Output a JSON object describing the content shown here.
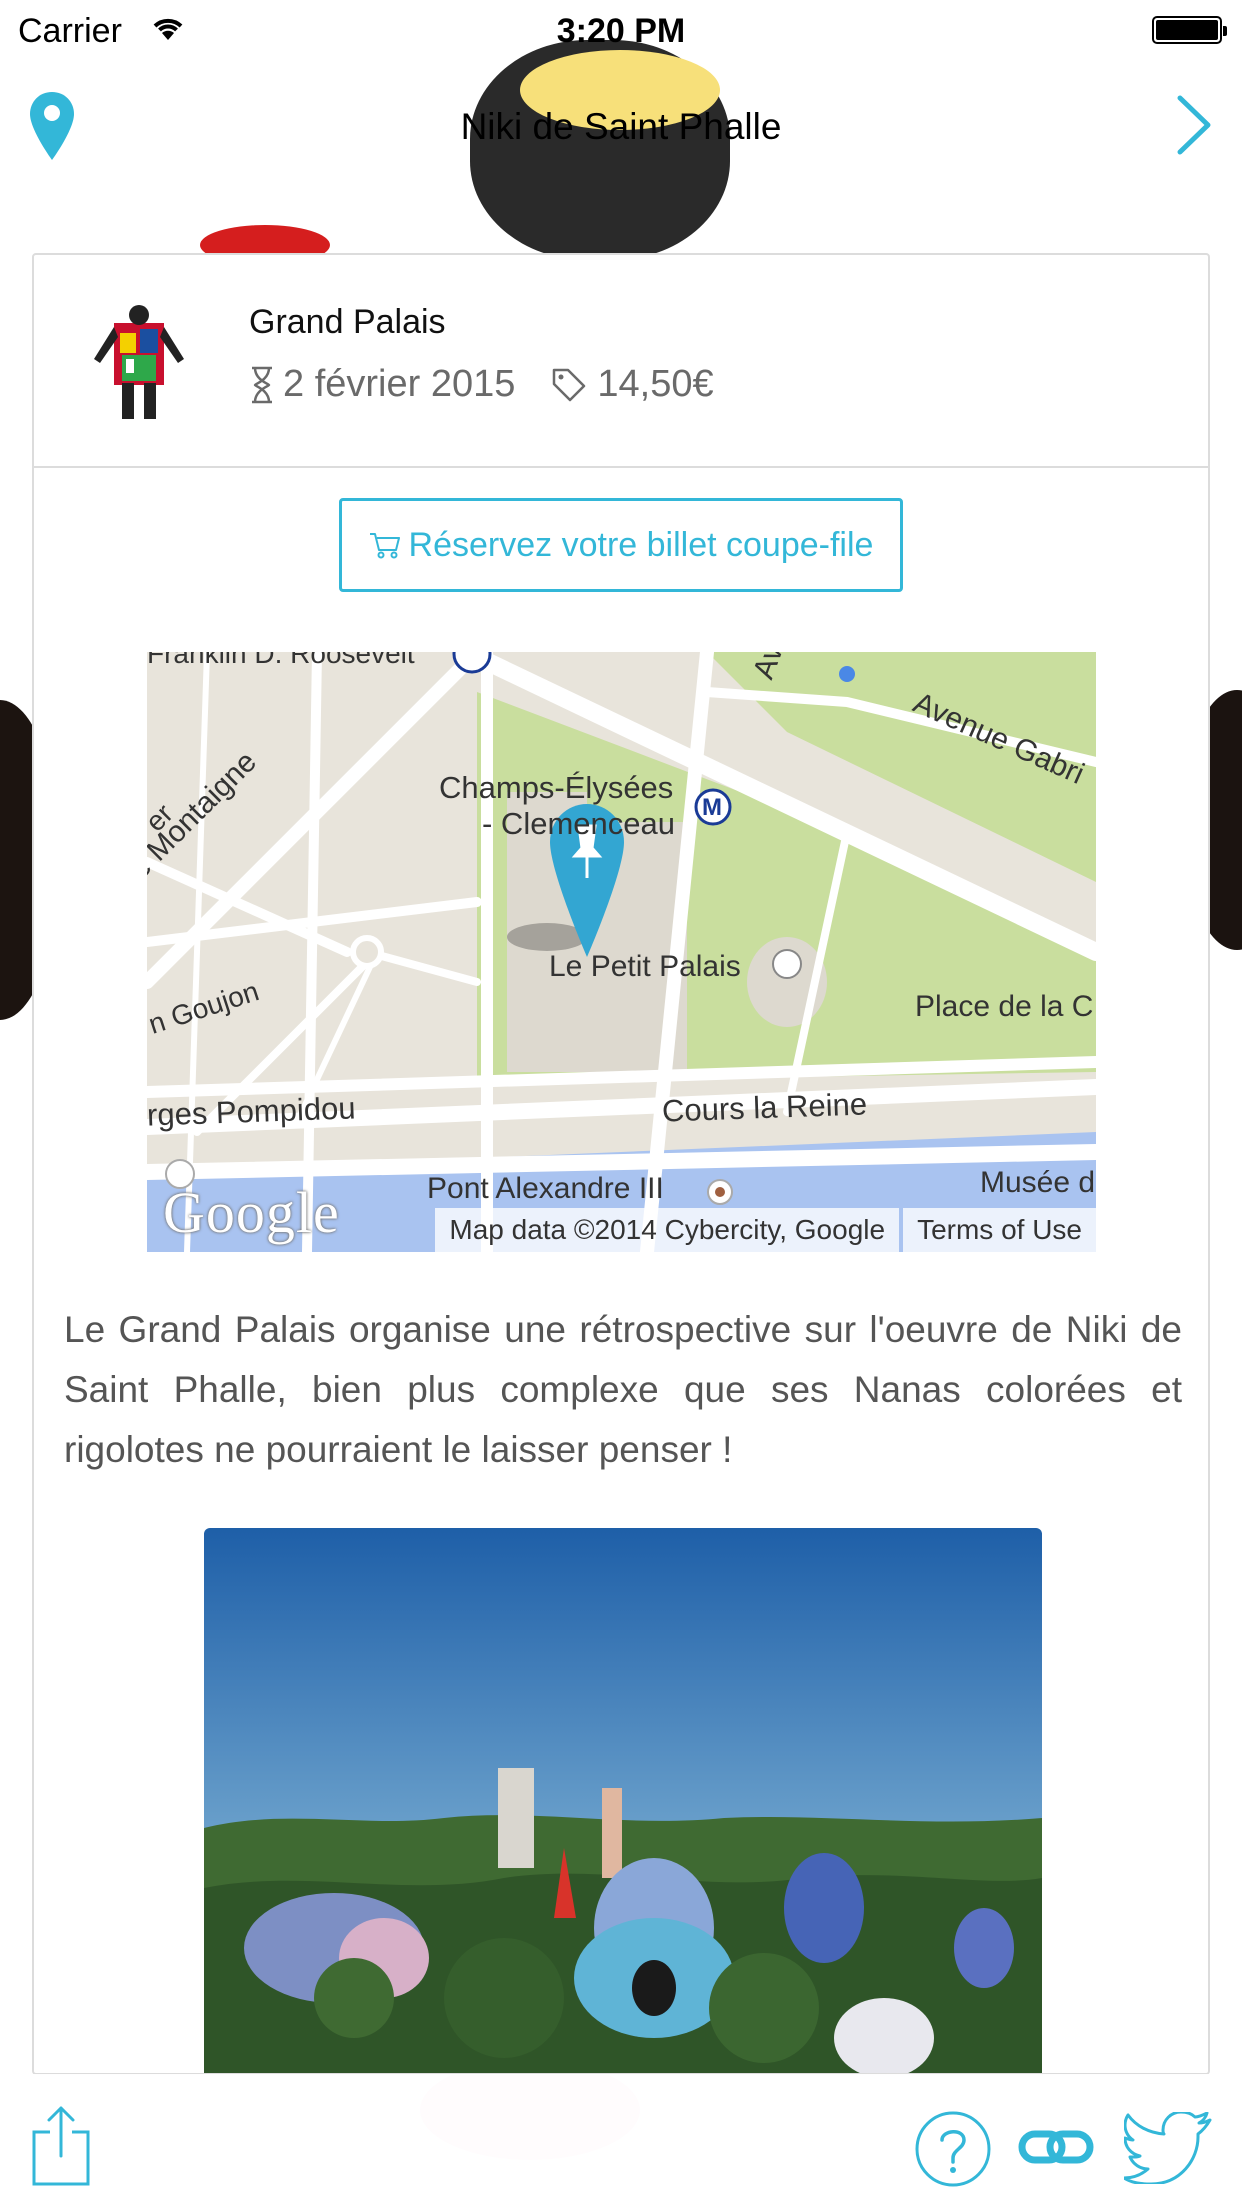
{
  "status_bar": {
    "carrier": "Carrier",
    "time": "3:20 PM"
  },
  "nav": {
    "title": "Niki de Saint Phalle",
    "left_icon": "map-pin-icon",
    "right_icon": "chevron-right-icon"
  },
  "event": {
    "venue": "Grand Palais",
    "end_date": "2 février 2015",
    "price": "14,50€"
  },
  "cta": {
    "label": "Réservez votre billet coupe-file"
  },
  "map": {
    "labels": {
      "roosevelt": "Franklin D. Roosevelt",
      "montaigne": "e Montaigne",
      "champs": "Champs-Élysées",
      "clemenceau": "- Clemenceau",
      "avenue": "Avenu",
      "avenue_gabriel": "Avenue Gabri",
      "petit_palais": "Le Petit Palais",
      "goujon": "n Goujon",
      "place": "Place de la C",
      "pompidou": "rges Pompidou",
      "cours": "Cours la Reine",
      "pont": "Pont Alexandre III",
      "musee": "Musée d",
      "er": "er"
    },
    "google_logo": "Google",
    "attribution": "Map data ©2014 Cybercity, Google",
    "terms": "Terms of Use"
  },
  "description": "Le Grand Palais organise une rétrospective sur l'oeuvre de Niki de Saint Phalle, bien plus complexe que ses Nanas colorées et rigolotes ne pourraient le laisser penser !",
  "toolbar": {
    "icons": [
      "share-icon",
      "help-icon",
      "link-icon",
      "twitter-icon"
    ]
  },
  "colors": {
    "accent": "#33b7d8",
    "text_muted": "#6a6a6a",
    "border": "#dcdcdc"
  }
}
